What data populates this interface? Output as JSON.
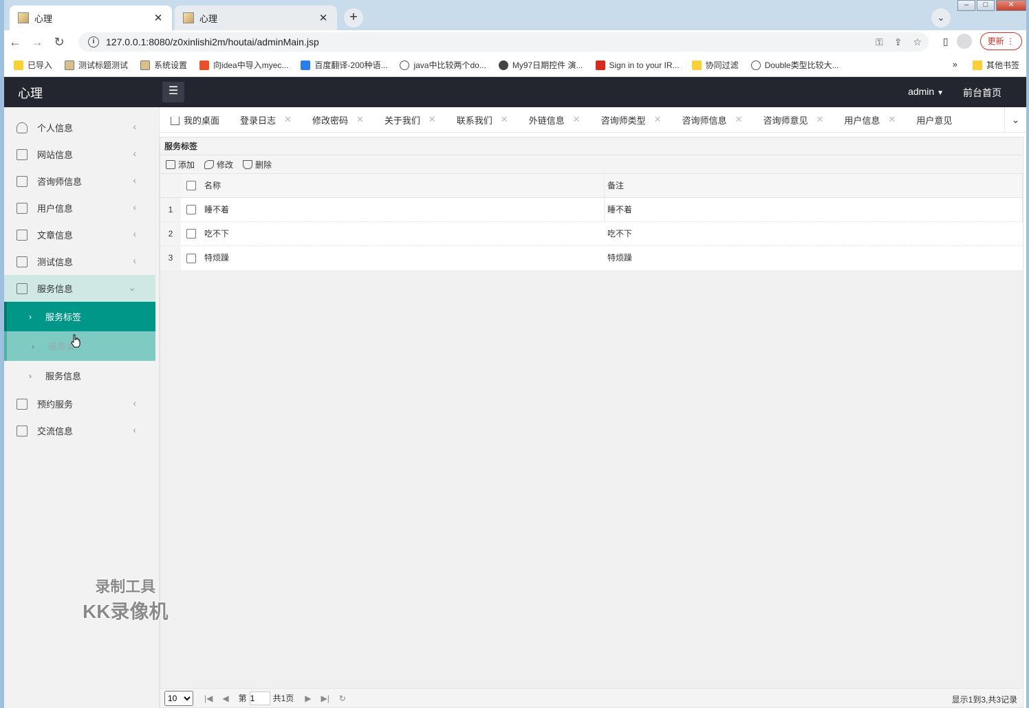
{
  "browser": {
    "tabs": [
      {
        "title": "心理",
        "active": true
      },
      {
        "title": "心理",
        "active": false
      }
    ],
    "url": "127.0.0.1:8080/z0xinlishi2m/houtai/adminMain.jsp",
    "update_label": "更新",
    "bookmarks": [
      "已导入",
      "测试标题测试",
      "系统设置",
      "向idea中导入myec...",
      "百度翻译-200种语...",
      "java中比较两个do...",
      "My97日期控件 演...",
      "Sign in to your IR...",
      "协同过滤",
      "Double类型比较大..."
    ],
    "bookmarks_more": "»",
    "other_bookmarks": "其他书签"
  },
  "app": {
    "logo": "心理",
    "user": "admin",
    "home_link": "前台首页"
  },
  "sidebar": {
    "items": [
      {
        "label": "个人信息"
      },
      {
        "label": "网站信息"
      },
      {
        "label": "咨询师信息"
      },
      {
        "label": "用户信息"
      },
      {
        "label": "文章信息"
      },
      {
        "label": "测试信息"
      },
      {
        "label": "服务信息"
      },
      {
        "label": "预约服务"
      },
      {
        "label": "交流信息"
      }
    ],
    "sub_items": [
      {
        "label": "服务标签"
      },
      {
        "label": "服务类"
      },
      {
        "label": "服务信息"
      }
    ]
  },
  "page_tabs": [
    "我的桌面",
    "登录日志",
    "修改密码",
    "关于我们",
    "联系我们",
    "外链信息",
    "咨询师类型",
    "咨询师信息",
    "咨询师意见",
    "用户信息",
    "用户意见"
  ],
  "panel": {
    "title": "服务标签",
    "toolbar": {
      "add": "添加",
      "edit": "修改",
      "delete": "删除"
    },
    "columns": [
      "名称",
      "备注"
    ],
    "rows": [
      {
        "n": "1",
        "name": "睡不着",
        "note": "睡不着"
      },
      {
        "n": "2",
        "name": "吃不下",
        "note": "吃不下"
      },
      {
        "n": "3",
        "name": "特烦躁",
        "note": "特烦躁"
      }
    ]
  },
  "pager": {
    "page_size": "10",
    "page_prefix": "第",
    "page_value": "1",
    "page_total": "共1页",
    "info": "显示1到3,共3记录"
  },
  "watermark": {
    "line1": "录制工具",
    "line2": "KK录像机"
  },
  "colors": {
    "accent": "#009688",
    "topbar": "#23262e"
  }
}
